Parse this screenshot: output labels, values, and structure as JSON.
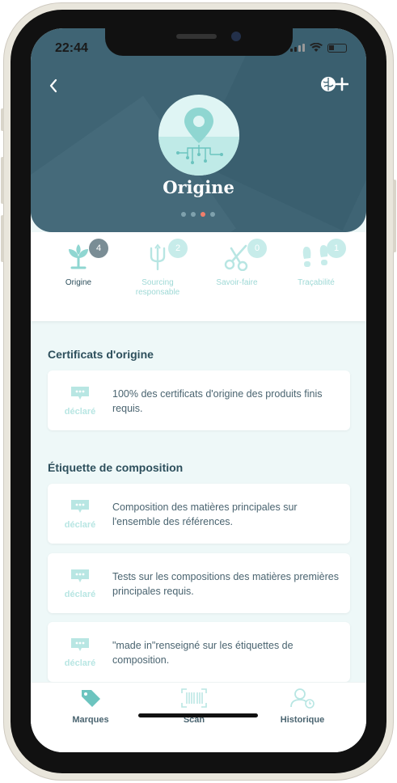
{
  "status": {
    "time": "22:44"
  },
  "header": {
    "back_icon": "chevron-left-icon",
    "add_icon": "brain-plus-icon",
    "title": "Origine",
    "hero_icon": "location-pin-network-icon",
    "page_dots": 4,
    "active_dot": 3
  },
  "tabs": [
    {
      "label": "Origine",
      "count": "4",
      "icon": "sprout-icon",
      "active": true
    },
    {
      "label": "Sourcing responsable",
      "count": "2",
      "icon": "trident-icon",
      "active": false
    },
    {
      "label": "Savoir-faire",
      "count": "0",
      "icon": "scissors-icon",
      "active": false
    },
    {
      "label": "Traçabilité",
      "count": "1",
      "icon": "footprints-icon",
      "active": false
    }
  ],
  "sections": [
    {
      "title": "Certificats d'origine",
      "cards": [
        {
          "tag": "déclaré",
          "text": "100% des certificats d'origine des produits finis requis."
        }
      ]
    },
    {
      "title": "Étiquette de composition",
      "cards": [
        {
          "tag": "déclaré",
          "text": "Composition des matières principales sur l'ensemble des références."
        },
        {
          "tag": "déclaré",
          "text": "Tests sur les compositions des matières premières principales requis."
        },
        {
          "tag": "déclaré",
          "text": " \"made in\"renseigné sur les étiquettes de composition."
        }
      ]
    }
  ],
  "bottom_nav": [
    {
      "label": "Marques",
      "icon": "tag-icon"
    },
    {
      "label": "Scan",
      "icon": "barcode-scan-icon"
    },
    {
      "label": "Historique",
      "icon": "user-history-icon"
    }
  ],
  "colors": {
    "header": "#3f6474",
    "accent": "#9fd9d6",
    "dot_active": "#f07e6b",
    "text": "#2d4f5c"
  }
}
